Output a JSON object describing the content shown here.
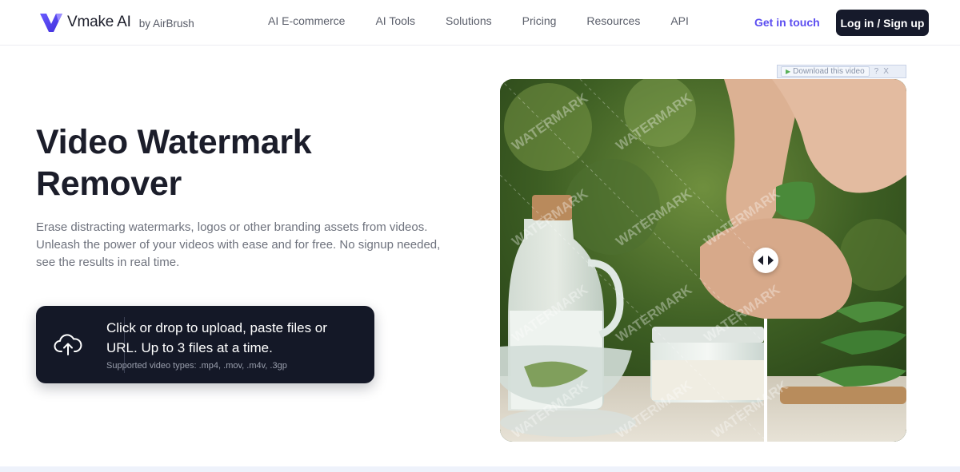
{
  "brand": {
    "name": "Vmake AI",
    "by": "by AirBrush",
    "accent": "#5b4df0"
  },
  "nav": {
    "items": [
      {
        "label": "AI E-commerce"
      },
      {
        "label": "AI Tools"
      },
      {
        "label": "Solutions"
      },
      {
        "label": "Pricing"
      },
      {
        "label": "Resources"
      },
      {
        "label": "API"
      }
    ],
    "get_in_touch": "Get in touch",
    "login": "Log in / Sign up"
  },
  "hero": {
    "title_line1": "Video Watermark",
    "title_line2": "Remover",
    "desc_line1": "Erase distracting watermarks, logos or other branding assets from videos.",
    "desc_line2": "Unleash the power of your videos with ease and for free. No signup needed,",
    "desc_line3": "see the results in real time."
  },
  "upload": {
    "main_line1": "Click or drop to upload, paste files or",
    "main_line2": "URL. Up to 3 files at a time.",
    "sub": "Supported video types: .mp4, .mov, .m4v, .3gp",
    "icon": "cloud-upload-icon"
  },
  "media": {
    "watermark_text": "WATERMARK",
    "download_label": "Download this video",
    "help": "?",
    "close": "X",
    "slider_icon": "compare-arrows-icon"
  }
}
